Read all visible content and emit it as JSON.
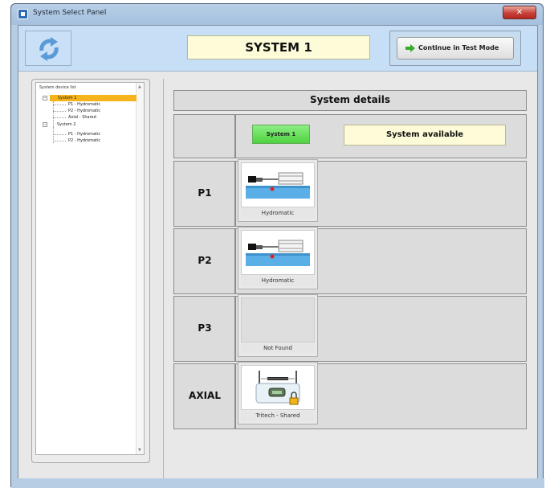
{
  "window": {
    "title": "System Select Panel",
    "close_glyph": "✕"
  },
  "header": {
    "system_title": "SYSTEM 1",
    "continue_label": "Continue in Test Mode",
    "refresh_icon": "refresh-arrows-icon"
  },
  "tree": {
    "label": "System device list",
    "scroll_up": "▲",
    "scroll_down": "▼",
    "expand_glyph": "−",
    "items": [
      {
        "label": "System 1",
        "selected": true
      },
      {
        "label": "P1 - Hydromatic"
      },
      {
        "label": "P2 - Hydromatic"
      },
      {
        "label": "Axial - Shared"
      },
      {
        "label": "System 2"
      },
      {
        "label": "P1 - Hydromatic"
      },
      {
        "label": "P2 - Hydromatic"
      }
    ]
  },
  "details": {
    "title": "System details",
    "system_button": "System 1",
    "status_text": "System available",
    "rows": [
      {
        "label": "P1",
        "device": "Hydromatic"
      },
      {
        "label": "P2",
        "device": "Hydromatic"
      },
      {
        "label": "P3",
        "device": "Not Found"
      },
      {
        "label": "AXIAL",
        "device": "Tritech - Shared"
      }
    ]
  },
  "colors": {
    "header_bg": "#c6dff6",
    "title_field": "#fefcd8",
    "selected_tree": "#f6b31b",
    "system_button": "#4ed340",
    "arrow_green": "#3aa82e"
  }
}
